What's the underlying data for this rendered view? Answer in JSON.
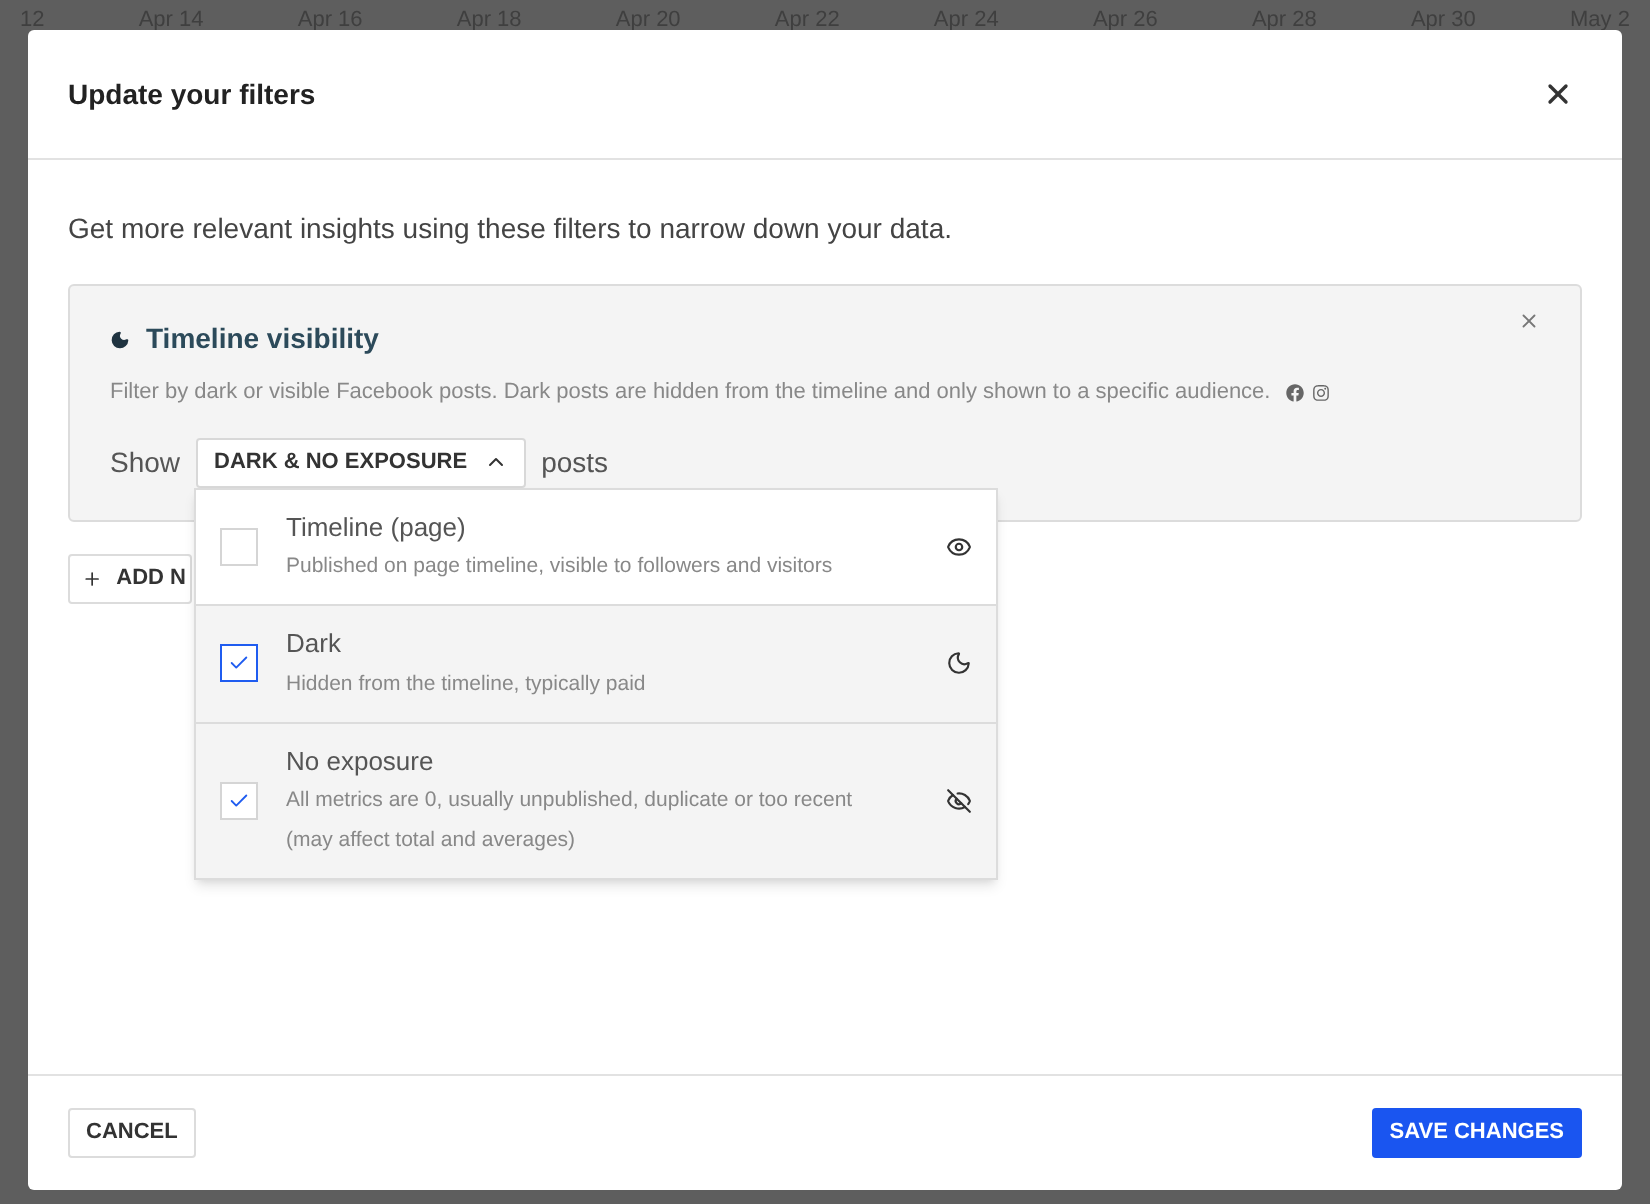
{
  "background": {
    "axis_labels": [
      "12",
      "Apr 14",
      "Apr 16",
      "Apr 18",
      "Apr 20",
      "Apr 22",
      "Apr 24",
      "Apr 26",
      "Apr 28",
      "Apr 30",
      "May 2"
    ]
  },
  "dialog": {
    "title": "Update your filters",
    "intro": "Get more relevant insights using these filters to narrow down your data.",
    "filter": {
      "title": "Timeline visibility",
      "description": "Filter by dark or visible Facebook posts. Dark posts are hidden from the timeline and only shown to a specific audience.",
      "prefix": "Show",
      "select": {
        "value": "DARK & NO EXPOSURE",
        "expanded": true
      },
      "suffix": "posts",
      "options": [
        {
          "label": "Timeline (page)",
          "description": "Published on page timeline, visible to followers and visitors",
          "checked": false,
          "focused": false,
          "kind": "eye"
        },
        {
          "label": "Dark",
          "description": "Hidden from the timeline, typically paid",
          "checked": true,
          "focused": true,
          "kind": "moon"
        },
        {
          "label": "No exposure",
          "description": "All metrics are 0, usually unpublished, duplicate or too recent (may affect total and averages)",
          "checked": true,
          "focused": false,
          "kind": "eye-off"
        }
      ]
    },
    "add_button": "ADD N",
    "cancel_button": "CANCEL",
    "save_button": "SAVE CHANGES"
  }
}
